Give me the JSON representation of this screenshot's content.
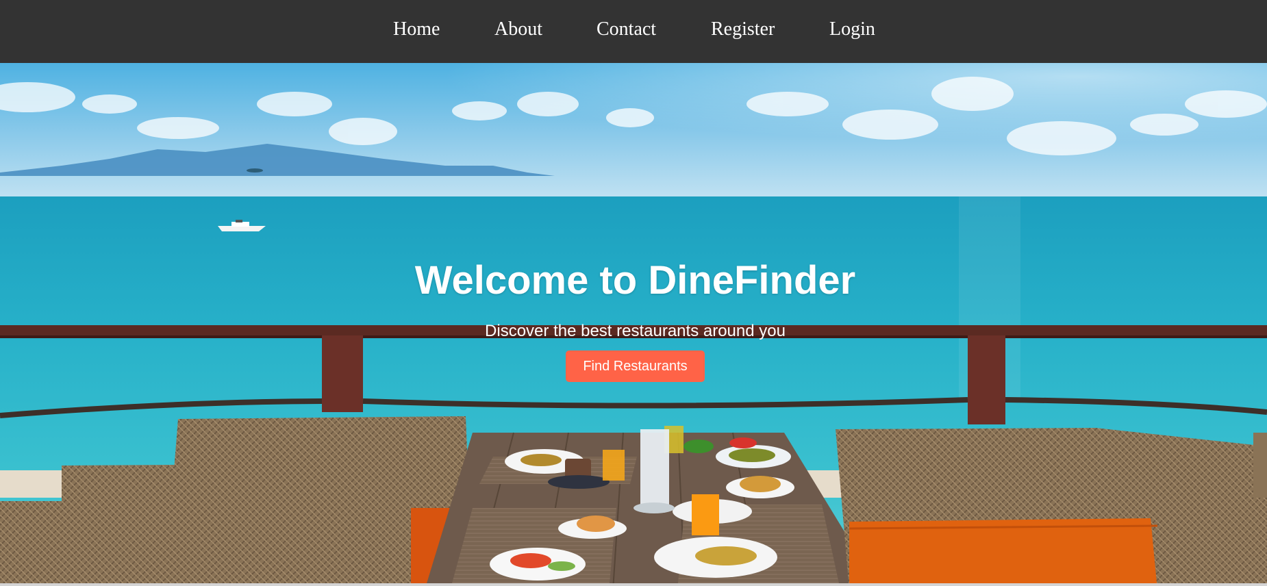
{
  "nav": {
    "items": [
      {
        "label": "Home"
      },
      {
        "label": "About"
      },
      {
        "label": "Contact"
      },
      {
        "label": "Register"
      },
      {
        "label": "Login"
      }
    ]
  },
  "hero": {
    "title": "Welcome to DineFinder",
    "subtitle": "Discover the best restaurants around you",
    "cta_label": "Find Restaurants",
    "background_image": "seaside-terrace-dining-photo"
  },
  "colors": {
    "navbar": "#333333",
    "nav_text": "#ffffff",
    "cta": "#ff6347",
    "cta_text": "#ffffff"
  }
}
